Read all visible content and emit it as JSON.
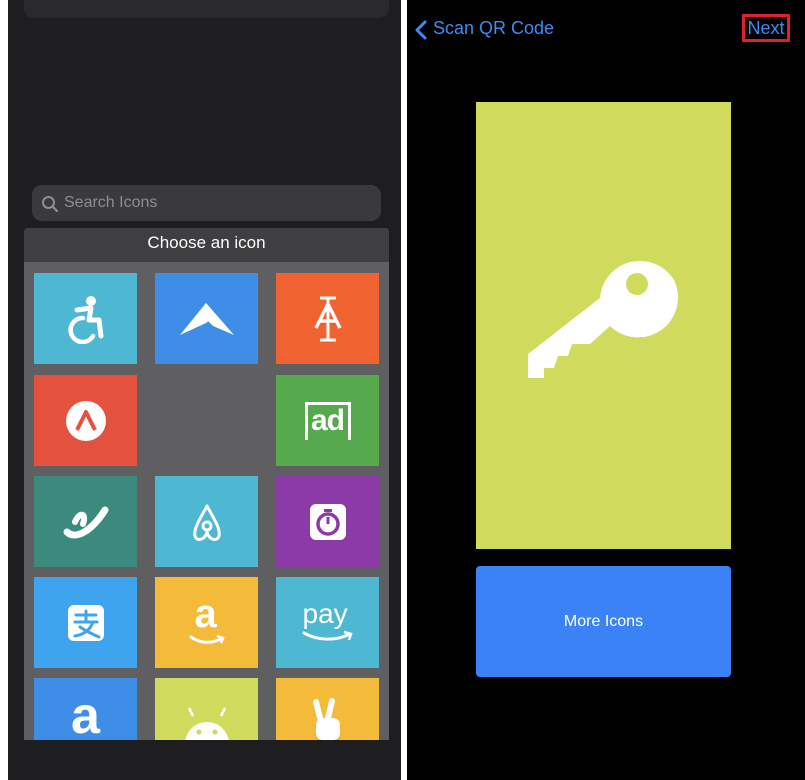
{
  "left_panel": {
    "search": {
      "placeholder": "Search Icons"
    },
    "chooser_title": "Choose an icon",
    "tiles": [
      {
        "icon": "wheelchair-icon",
        "color": "#4eb8d2"
      },
      {
        "icon": "delta-logo-icon",
        "color": "#3e8ee8"
      },
      {
        "icon": "text-cursor-icon",
        "color": "#f0622f"
      },
      {
        "icon": "letter-a-logo-icon",
        "color": "#e4513f"
      },
      {
        "icon": "empty",
        "color": "#5f5f61"
      },
      {
        "icon": "adwords-icon",
        "color": "#57a94d"
      },
      {
        "icon": "swirl-logo-icon",
        "color": "#3c8a7e"
      },
      {
        "icon": "airbnb-icon",
        "color": "#4eb8d2"
      },
      {
        "icon": "stopwatch-icon",
        "color": "#8d3aa9"
      },
      {
        "icon": "alipay-icon",
        "color": "#3ea4ee"
      },
      {
        "icon": "amazon-icon",
        "color": "#f4bb3a"
      },
      {
        "icon": "amazon-pay-icon",
        "color": "#4eb8d2"
      },
      {
        "icon": "letter-a-icon",
        "color": "#3e8ee8"
      },
      {
        "icon": "android-icon",
        "color": "#d0db5d"
      },
      {
        "icon": "peace-hand-icon",
        "color": "#f4bb3a"
      }
    ],
    "tile_text": {
      "ad": "ad",
      "pay": "pay",
      "a": "a"
    }
  },
  "right_panel": {
    "back_label": "Scan QR Code",
    "next_label": "Next",
    "selected_icon": {
      "icon": "key-icon",
      "color": "#d0db5d"
    },
    "more_icons_label": "More Icons",
    "colors": {
      "accent": "#3d8cf5",
      "highlight_border": "#e0202a",
      "button": "#3b82f6"
    }
  }
}
